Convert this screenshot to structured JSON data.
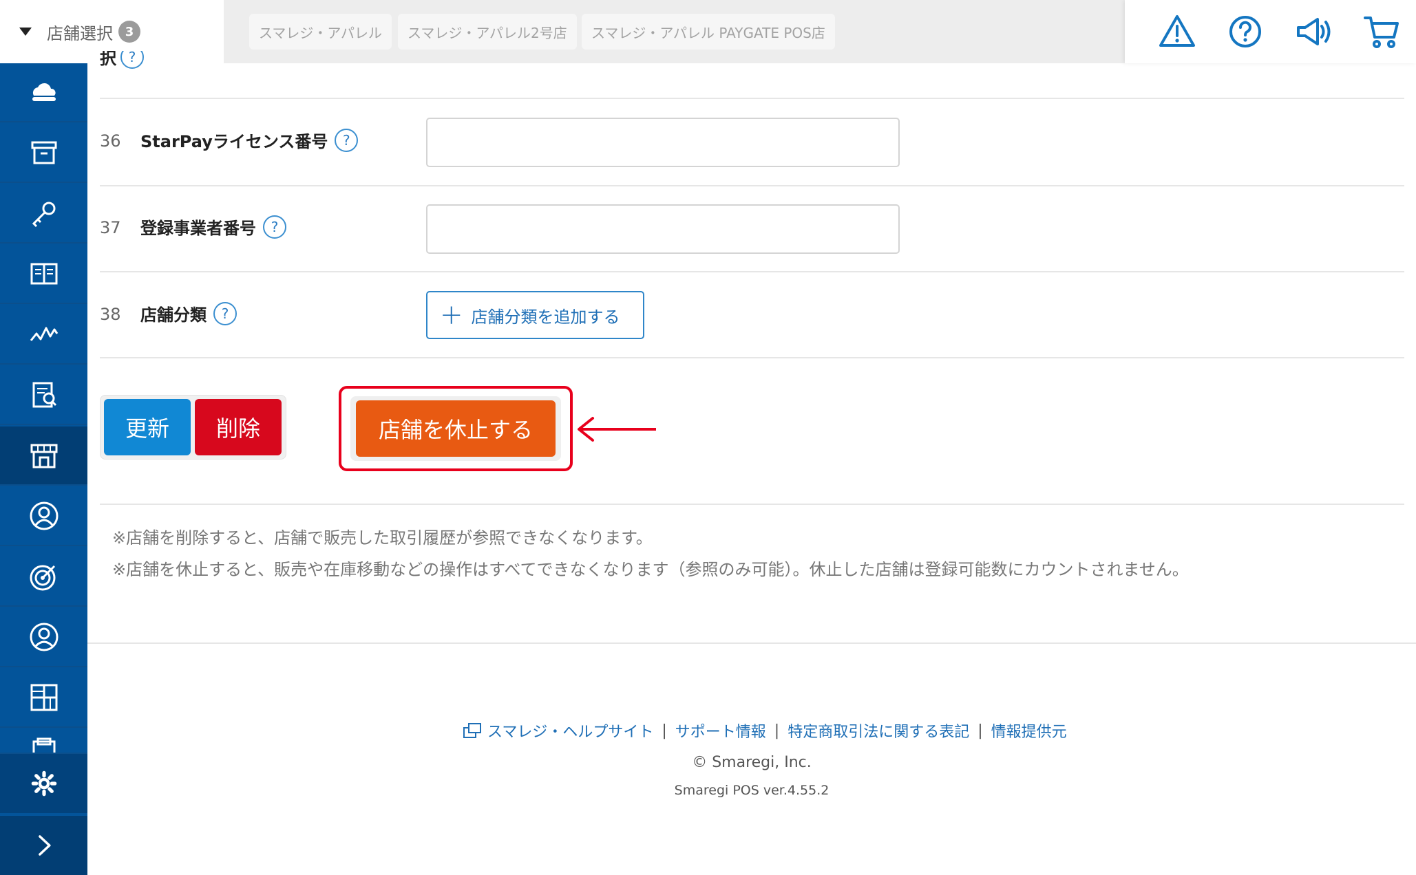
{
  "header": {
    "store_select_label": "店舗選択",
    "store_count": "3",
    "store_tabs": [
      "スマレジ・アパレル",
      "スマレジ・アパレル2号店",
      "スマレジ・アパレル PAYGATE POS店"
    ],
    "icons": [
      "warning-icon",
      "help-icon",
      "megaphone-icon",
      "cart-icon"
    ]
  },
  "sidebar": {
    "items": [
      "cloud-icon",
      "archive-icon",
      "key-icon",
      "book-icon",
      "chart-icon",
      "report-icon",
      "store-icon",
      "customer-icon",
      "target-icon",
      "user-icon",
      "grid-icon",
      "clipboard-icon"
    ],
    "active": "store-icon",
    "bottom": [
      "gear-icon",
      "chevron-right-icon"
    ],
    "color": "#03549a"
  },
  "main": {
    "cut_label": "択",
    "rows": [
      {
        "num": "36",
        "label": "StarPayライセンス番号",
        "value": ""
      },
      {
        "num": "37",
        "label": "登録事業者番号",
        "value": ""
      },
      {
        "num": "38",
        "label": "店舗分類",
        "button": "店舗分類を追加する"
      }
    ],
    "help_mark": "?",
    "buttons": {
      "update": "更新",
      "delete": "削除",
      "pause": "店舗を休止する"
    },
    "notes": [
      "※店舗を削除すると、店舗で販売した取引履歴が参照できなくなります。",
      "※店舗を休止すると、販売や在庫移動などの操作はすべてできなくなります（参照のみ可能）。休止した店舗は登録可能数にカウントされません。"
    ]
  },
  "footer": {
    "links": [
      "スマレジ・ヘルプサイト",
      "サポート情報",
      "特定商取引法に関する表記",
      "情報提供元"
    ],
    "separator": "|",
    "copyright": "© Smaregi, Inc.",
    "version": "Smaregi POS ver.4.55.2"
  },
  "colors": {
    "accent_blue": "#1188d4",
    "delete_red": "#d7081d",
    "pause_orange": "#e85a12",
    "highlight_red": "#e8001c"
  }
}
